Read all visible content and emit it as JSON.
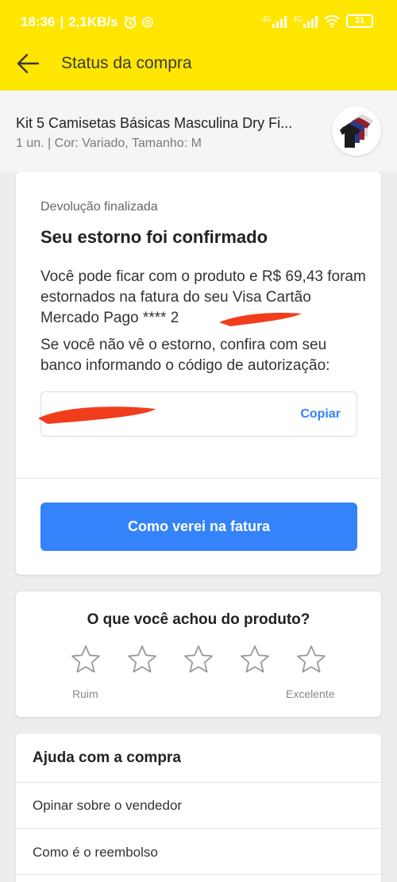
{
  "status_bar": {
    "time": "18:36",
    "speed": "2,1KB/s",
    "net1": "4G",
    "net2": "4G",
    "battery": "21"
  },
  "app_bar": {
    "title": "Status da compra",
    "back_icon": "arrow-left-icon"
  },
  "product": {
    "title": "Kit 5 Camisetas Básicas Masculina Dry Fi...",
    "meta": "1 un. | Cor: Variado, Tamanho: M"
  },
  "refund": {
    "overline": "Devolução finalizada",
    "title": "Seu estorno foi confirmado",
    "message": "Você pode ficar com o produto e R$ 69,43 foram estornados na fatura do seu Visa Cartão Mercado Pago **** 2",
    "instructions": "Se você não vê o estorno, confira com seu banco informando o código de autorização:",
    "copy_label": "Copiar",
    "primary_button": "Como verei na fatura"
  },
  "rating": {
    "question": "O que você achou do produto?",
    "star_count": 5,
    "low_label": "Ruim",
    "high_label": "Excelente"
  },
  "help": {
    "title": "Ajuda com a compra",
    "items": [
      "Opinar sobre o vendedor",
      "Como é o reembolso"
    ]
  },
  "colors": {
    "brand_yellow": "#ffe600",
    "action_blue": "#3483fa",
    "redaction_red": "#f23d1c"
  }
}
